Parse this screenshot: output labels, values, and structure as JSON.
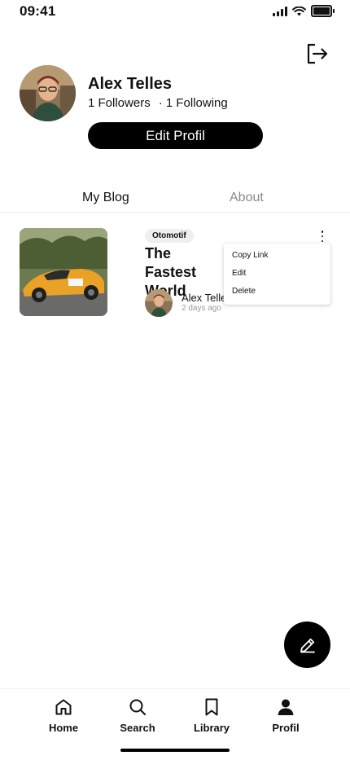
{
  "status_bar": {
    "time": "09:41"
  },
  "profile": {
    "name": "Alex Telles",
    "followers": "1 Followers",
    "following": "· 1 Following",
    "edit_button": "Edit Profil"
  },
  "tabs": [
    {
      "label": "My Blog",
      "active": true
    },
    {
      "label": "About",
      "active": false
    }
  ],
  "post": {
    "category": "Otomotif",
    "title": "The Fastest World",
    "author": "Alex Telle",
    "time": "2 days ago"
  },
  "post_menu": {
    "items": [
      "Copy Link",
      "Edit",
      "Delete"
    ]
  },
  "bottom_nav": {
    "items": [
      {
        "label": "Home",
        "icon": "home-icon"
      },
      {
        "label": "Search",
        "icon": "search-icon"
      },
      {
        "label": "Library",
        "icon": "bookmark-icon"
      },
      {
        "label": "Profil",
        "icon": "user-icon",
        "active": true
      }
    ]
  },
  "colors": {
    "primary": "#000000",
    "muted": "#8a8a8a",
    "chip_bg": "#efefef",
    "accent_car": "#e9a126"
  }
}
